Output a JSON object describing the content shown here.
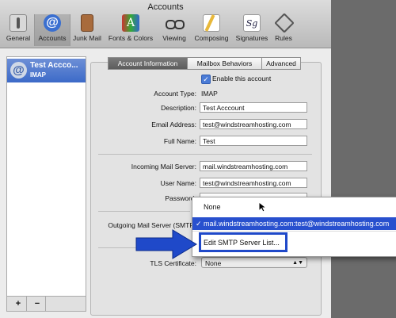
{
  "window": {
    "title": "Accounts"
  },
  "toolbar": {
    "items": [
      {
        "label": "General",
        "icon": "switch-icon"
      },
      {
        "label": "Accounts",
        "icon": "at-sign-icon"
      },
      {
        "label": "Junk Mail",
        "icon": "trash-icon"
      },
      {
        "label": "Fonts & Colors",
        "icon": "fonts-colors-icon"
      },
      {
        "label": "Viewing",
        "icon": "glasses-icon"
      },
      {
        "label": "Composing",
        "icon": "pencil-paper-icon"
      },
      {
        "label": "Signatures",
        "icon": "signature-icon"
      },
      {
        "label": "Rules",
        "icon": "rules-icon"
      }
    ]
  },
  "sidebar": {
    "account": {
      "name": "Test Accco...",
      "type": "IMAP"
    },
    "add_label": "+",
    "remove_label": "−"
  },
  "tabs": {
    "account_information": "Account Information",
    "mailbox_behaviors": "Mailbox Behaviors",
    "advanced": "Advanced"
  },
  "form": {
    "enable_label": "Enable this account",
    "enable_checked": true,
    "account_type_label": "Account Type:",
    "account_type_value": "IMAP",
    "description_label": "Description:",
    "description_value": "Test Acccount",
    "email_label": "Email Address:",
    "email_value": "test@windstreamhosting.com",
    "fullname_label": "Full Name:",
    "fullname_value": "Test",
    "incoming_label": "Incoming Mail Server:",
    "incoming_value": "mail.windstreamhosting.com",
    "username_label": "User Name:",
    "username_value": "test@windstreamhosting.com",
    "password_label": "Password:",
    "password_value": "••••",
    "outgoing_label": "Outgoing Mail Server (SMTP",
    "tls_label": "TLS Certificate:",
    "tls_value": "None"
  },
  "smtp_menu": {
    "items": [
      {
        "label": "None",
        "checked": false
      },
      {
        "label": "mail.windstreamhosting.com:test@windstreamhosting.com",
        "checked": true
      },
      {
        "label": "Edit SMTP Server List...",
        "checked": false
      }
    ],
    "check_glyph": "✓"
  },
  "colors": {
    "selection": "#2850ce",
    "annotation_blue": "#1f49c9"
  }
}
